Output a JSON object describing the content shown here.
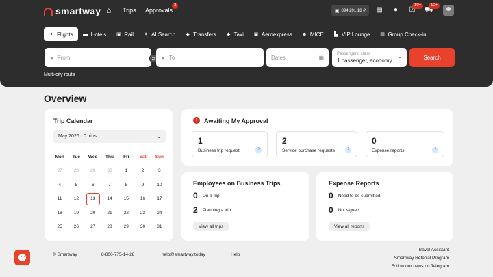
{
  "topbar": {
    "brand": "smartway",
    "nav": {
      "trips": "Trips",
      "approvals": "Approvals",
      "approvals_badge": "3"
    },
    "balance": "894,201.18 ₽",
    "icons": [
      "wallet-icon",
      "document-icon",
      "chat-icon",
      "tasks-icon",
      "cart-icon"
    ],
    "badges": {
      "tasks": "10+",
      "cart": "10+"
    }
  },
  "tabs": [
    {
      "label": "Flights",
      "icon": "plane-icon",
      "active": true
    },
    {
      "label": "Hotels",
      "icon": "bed-icon"
    },
    {
      "label": "Rail",
      "icon": "train-icon"
    },
    {
      "label": "AI Search",
      "icon": "sparkle-icon"
    },
    {
      "label": "Transfers",
      "icon": "car-icon"
    },
    {
      "label": "Taxi",
      "icon": "taxi-icon"
    },
    {
      "label": "Aeroexpress",
      "icon": "train-icon"
    },
    {
      "label": "MICE",
      "icon": "people-icon"
    },
    {
      "label": "VIP Lounge",
      "icon": "lounge-icon"
    },
    {
      "label": "Group Check-in",
      "icon": "suitcase-icon"
    }
  ],
  "search": {
    "from_placeholder": "From",
    "to_placeholder": "To",
    "date_placeholder": "Dates",
    "passengers_label": "Passengers, class",
    "passengers_value": "1 passenger, economy",
    "button": "Search",
    "multi_city": "Multi-city route"
  },
  "overview_title": "Overview",
  "calendar": {
    "title": "Trip Calendar",
    "month": "May 2026 · 0 trips",
    "weekdays": [
      "Mon",
      "Tue",
      "Wed",
      "Thu",
      "Fri",
      "Sat",
      "Sun"
    ],
    "weeks": [
      [
        "27",
        "28",
        "29",
        "30",
        "1",
        "2",
        "3"
      ],
      [
        "4",
        "5",
        "6",
        "7",
        "8",
        "9",
        "10"
      ],
      [
        "11",
        "12",
        "13",
        "14",
        "15",
        "16",
        "17"
      ],
      [
        "18",
        "19",
        "20",
        "21",
        "22",
        "23",
        "24"
      ],
      [
        "25",
        "26",
        "27",
        "28",
        "29",
        "30",
        "31"
      ]
    ],
    "today": "13"
  },
  "approval": {
    "title": "Awaiting My Approval",
    "items": [
      {
        "count": "1",
        "label": "Business trip request"
      },
      {
        "count": "2",
        "label": "Service purchase requests"
      },
      {
        "count": "0",
        "label": "Expense reports"
      }
    ]
  },
  "employees": {
    "title": "Employees on Business Trips",
    "on_trip_count": "0",
    "on_trip_label": "On a trip",
    "planning_count": "2",
    "planning_label": "Planning a trip",
    "button": "View all trips"
  },
  "expenses": {
    "title": "Expense Reports",
    "submit_count": "0",
    "submit_label": "Need to be submitted",
    "unsigned_count": "0",
    "unsigned_label": "Not signed",
    "button": "View all reports"
  },
  "footer": {
    "copyright": "© Smartway",
    "phone": "8-800-775-14-28",
    "email": "help@smartway.today",
    "help": "Help",
    "links": [
      "Travel Assistant",
      "Smartway Referral Program",
      "Follow our news on Telegram"
    ]
  },
  "colors": {
    "accent": "#e8412c",
    "header": "#2d2d2d",
    "background": "#efefef"
  }
}
